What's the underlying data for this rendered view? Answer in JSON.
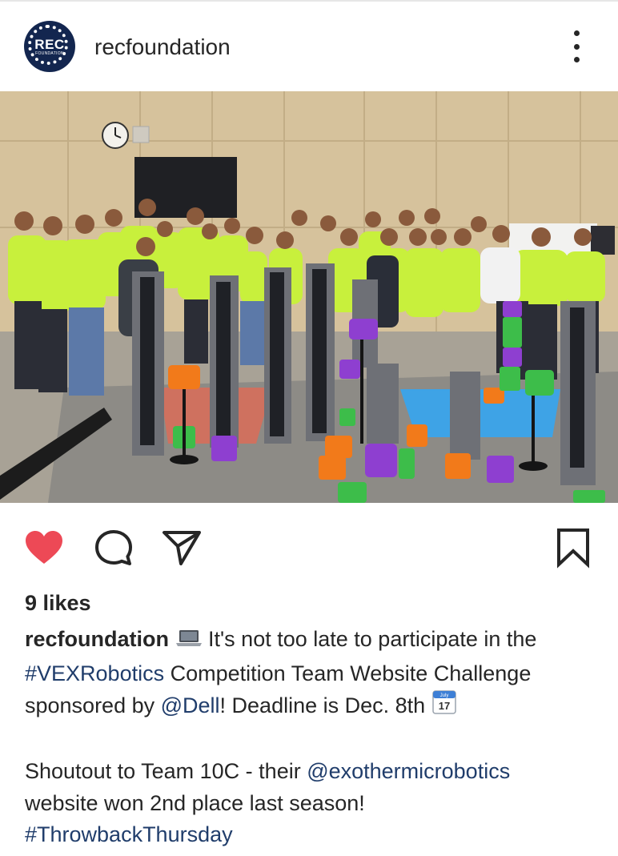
{
  "post": {
    "username": "recfoundation",
    "avatar_logo": {
      "big": "REC",
      "small": "FOUNDATION"
    },
    "likes_text": "9 likes",
    "liked": true,
    "caption": {
      "username": "recfoundation",
      "laptop_icon": "laptop-emoji",
      "line1": " It's not too late to participate in the",
      "hashtag1": "#VEXRobotics",
      "line2": " Competition Team Website Challenge",
      "line3_pre": "sponsored by ",
      "mention1": "@Dell",
      "line3_post": "! Deadline is Dec. 8th ",
      "calendar_icon": {
        "name": "calendar-emoji",
        "month": "July",
        "day": "17"
      },
      "para2_pre": "Shoutout to Team 10C - their ",
      "mention2": "@exothermicrobotics",
      "para2_line2": "website won 2nd place last season!",
      "hashtag2": "#ThrowbackThursday"
    }
  },
  "icons": {
    "more": "more-options-icon",
    "like": "heart-icon",
    "comment": "comment-icon",
    "share": "share-icon",
    "save": "bookmark-icon"
  },
  "colors": {
    "heart": "#ed4956",
    "link": "#203d6b",
    "text": "#262626",
    "avatar_bg": "#13264f",
    "shirts": "#c8f03c"
  }
}
